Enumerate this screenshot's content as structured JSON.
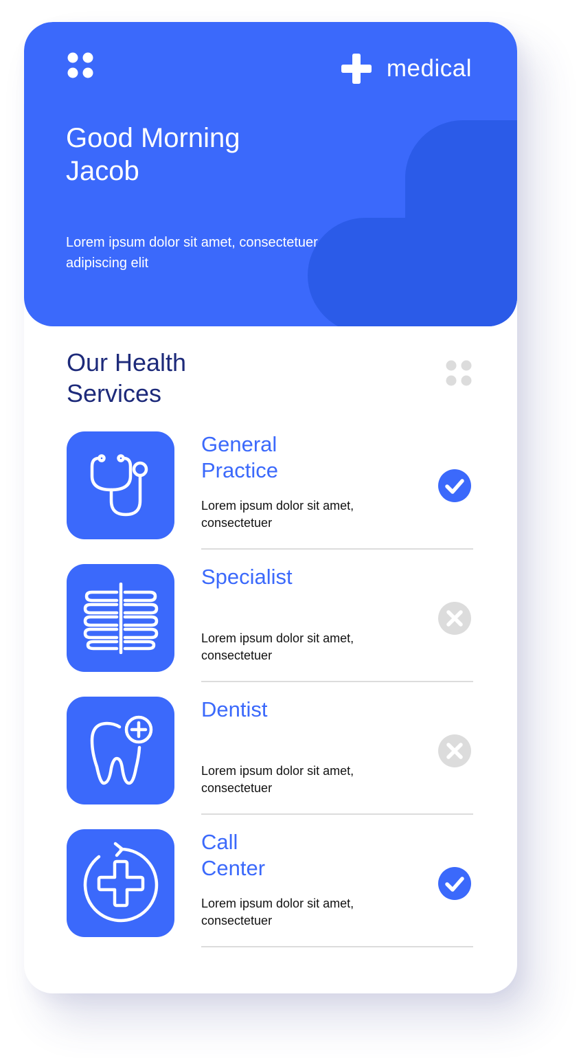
{
  "brand": {
    "name": "medical",
    "icon": "plus-icon"
  },
  "header": {
    "greeting_line1": "Good Morning",
    "greeting_line2": "Jacob",
    "subtitle": "Lorem ipsum dolor sit amet, consectetuer adipiscing elit",
    "menu_icon": "grid-dots-icon"
  },
  "services_section": {
    "title_line1": "Our Health",
    "title_line2": "Services",
    "more_icon": "grid-dots-icon",
    "items": [
      {
        "name_line1": "General",
        "name_line2": "Practice",
        "description": "Lorem ipsum dolor sit amet, consectetuer",
        "icon": "stethoscope-icon",
        "status": "checked"
      },
      {
        "name_line1": "Specialist",
        "name_line2": "",
        "description": "Lorem ipsum dolor sit amet, consectetuer",
        "icon": "ribcage-icon",
        "status": "unchecked"
      },
      {
        "name_line1": "Dentist",
        "name_line2": "",
        "description": "Lorem ipsum dolor sit amet, consectetuer",
        "icon": "tooth-plus-icon",
        "status": "unchecked"
      },
      {
        "name_line1": "Call",
        "name_line2": "Center",
        "description": "Lorem ipsum dolor sit amet, consectetuer",
        "icon": "medical-cross-circle-icon",
        "status": "checked"
      }
    ]
  },
  "colors": {
    "primary": "#3b69fb",
    "primary_dark": "#2b5be8",
    "title_navy": "#1d2a7a",
    "inactive_gray": "#dcdcdc",
    "text_dark": "#111111",
    "card_bg": "#ffffff"
  }
}
